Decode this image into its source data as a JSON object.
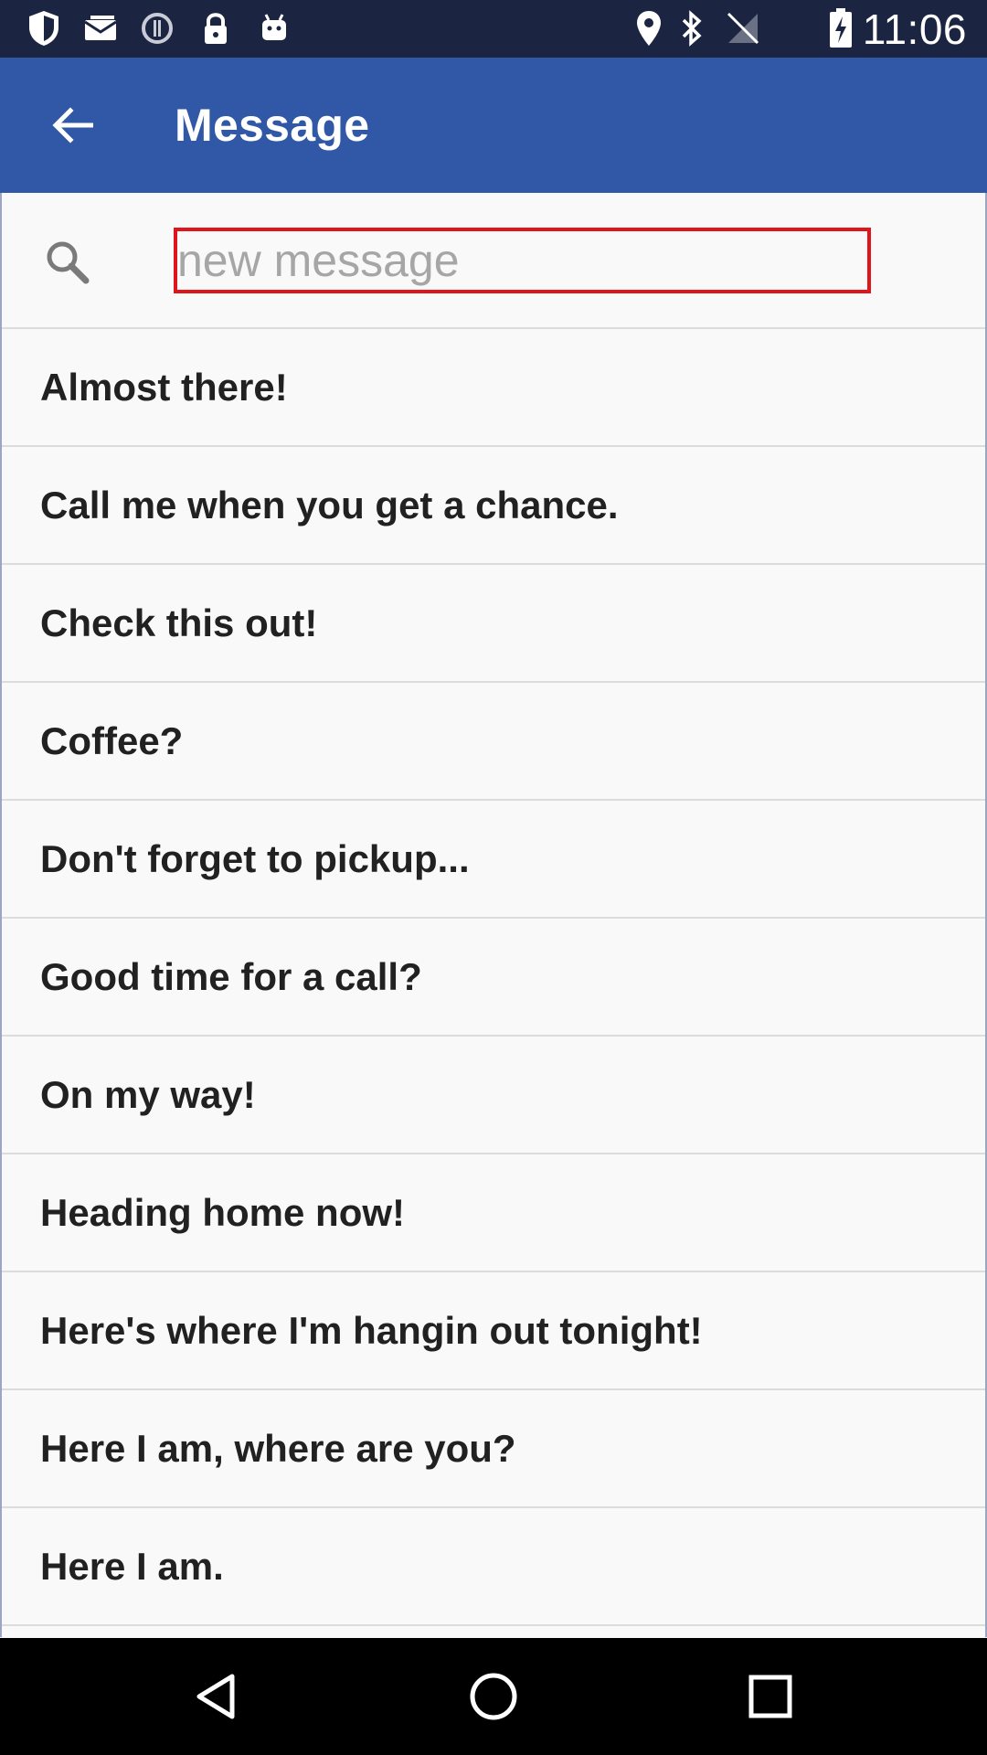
{
  "status_bar": {
    "time": "11:06",
    "left_icons": [
      "shield-icon",
      "mail-icon",
      "alert-circle-icon",
      "lock-icon",
      "android-icon"
    ],
    "right_icons": [
      "location-pin-icon",
      "bluetooth-icon",
      "no-signal-icon",
      "battery-charging-icon"
    ]
  },
  "app_bar": {
    "back_icon": "arrow-back-icon",
    "title": "Message",
    "color": "#3158a6"
  },
  "search": {
    "icon": "search-icon",
    "placeholder": "new message",
    "value": "",
    "highlight_color": "#e0141b"
  },
  "messages": [
    "Almost there!",
    "Call me when you get a chance.",
    "Check this out!",
    "Coffee?",
    "Don't forget to pickup...",
    "Good time for a call?",
    "On my way!",
    "Heading home now!",
    "Here's where I'm hangin out tonight!",
    "Here I am, where are you?",
    "Here I am."
  ],
  "nav_bar": {
    "buttons": [
      "back-triangle-icon",
      "home-circle-icon",
      "recents-square-icon"
    ]
  }
}
